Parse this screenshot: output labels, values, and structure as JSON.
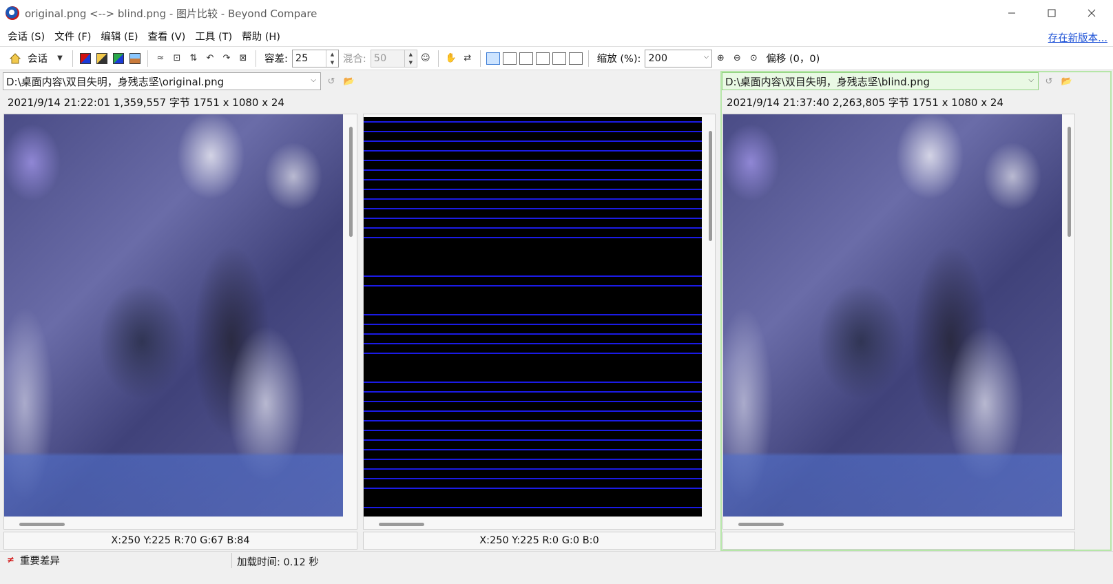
{
  "window": {
    "title": "original.png <--> blind.png - 图片比较 - Beyond Compare"
  },
  "menu": {
    "items": [
      "会话 (S)",
      "文件 (F)",
      "编辑 (E)",
      "查看 (V)",
      "工具 (T)",
      "帮助 (H)"
    ],
    "new_version": "存在新版本..."
  },
  "toolbar": {
    "session_label": "会话",
    "tolerance_label": "容差:",
    "tolerance_value": "25",
    "blend_label": "混合:",
    "blend_value": "50",
    "zoom_label": "缩放 (%):",
    "zoom_value": "200",
    "offset_label": "偏移 (0，0)"
  },
  "left": {
    "path": "D:\\桌面内容\\双目失明，身残志坚\\original.png",
    "info": "2021/9/14 21:22:01   1,359,557 字节   1751 x 1080 x 24",
    "coords": "X:250 Y:225 R:70 G:67 B:84"
  },
  "center": {
    "coords": "X:250 Y:225 R:0 G:0 B:0"
  },
  "right": {
    "path": "D:\\桌面内容\\双目失明，身残志坚\\blind.png",
    "info": "2021/9/14 21:37:40   2,263,805 字节   1751 x 1080 x 24",
    "coords": ""
  },
  "status": {
    "label": "重要差异",
    "load_time": "加载时间:  0.12 秒"
  },
  "colors": {
    "accent_link": "#1a4fd6",
    "diff_pixels": "#1e1eff",
    "right_path_bg": "#e9f9e4",
    "status_icon": "#d01010"
  }
}
